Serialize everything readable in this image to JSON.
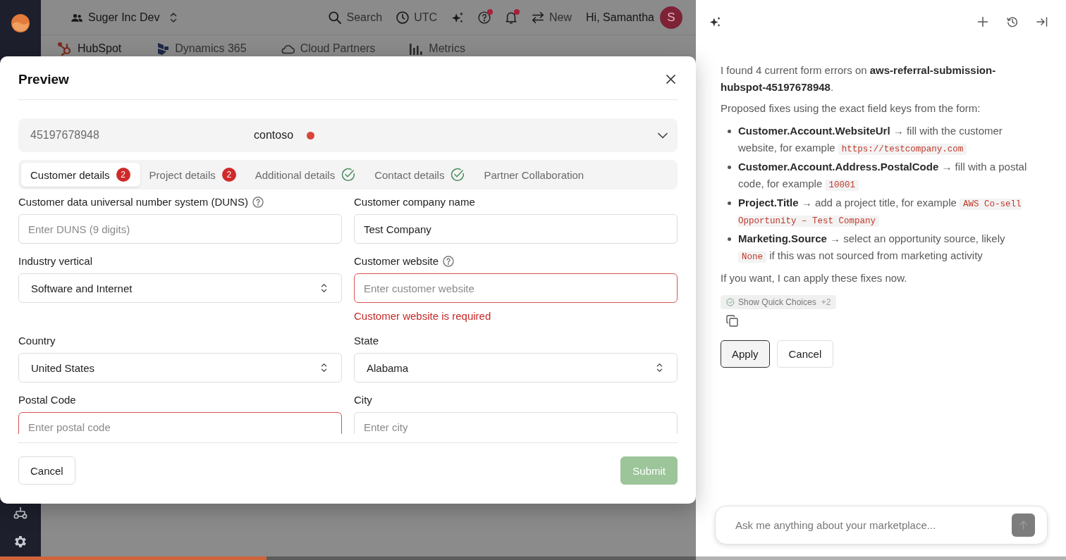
{
  "top_bar": {
    "workspace": "Suger Inc Dev",
    "search": "Search",
    "timezone": "UTC",
    "help": {
      "unread": true
    },
    "notifications": {
      "unread": true
    },
    "new": "New",
    "greeting": "Hi, Samantha",
    "avatar": "S"
  },
  "nav_tabs": [
    {
      "label": "HubSpot",
      "selected": true
    },
    {
      "label": "Dynamics 365",
      "selected": false
    },
    {
      "label": "Cloud Partners",
      "selected": false
    },
    {
      "label": "Metrics",
      "selected": false
    }
  ],
  "dialog": {
    "title": "Preview",
    "record": {
      "id": "45197678948",
      "name": "contoso",
      "error": true
    },
    "steps": [
      {
        "label": "Customer details",
        "selected": true,
        "kind": "errors",
        "count": "2"
      },
      {
        "label": "Project details",
        "selected": false,
        "kind": "errors",
        "count": "2"
      },
      {
        "label": "Additional details",
        "selected": false,
        "kind": "complete"
      },
      {
        "label": "Contact details",
        "selected": false,
        "kind": "complete"
      },
      {
        "label": "Partner Collaboration",
        "selected": false,
        "kind": "plain"
      }
    ],
    "fields": [
      {
        "label": "Customer data universal number system (DUNS)",
        "kind": "input",
        "help": true,
        "placeholder": "Enter DUNS (9 digits)",
        "invalid": false
      },
      {
        "label": "Customer company name",
        "kind": "input",
        "help": false,
        "value": "Test Company",
        "invalid": false
      },
      {
        "label": "Industry vertical",
        "kind": "select",
        "help": false,
        "value": "Software and Internet",
        "invalid": false
      },
      {
        "label": "Customer website",
        "kind": "input",
        "help": true,
        "placeholder": "Enter customer website",
        "invalid": true,
        "error": "Customer website is required"
      },
      {
        "label": "Country",
        "kind": "select",
        "help": false,
        "value": "United States",
        "invalid": false
      },
      {
        "label": "State",
        "kind": "select",
        "help": false,
        "value": "Alabama",
        "invalid": false
      },
      {
        "label": "Postal Code",
        "kind": "input",
        "help": false,
        "placeholder": "Enter postal code",
        "invalid": true
      },
      {
        "label": "City",
        "kind": "input",
        "help": false,
        "placeholder": "Enter city",
        "invalid": false
      }
    ],
    "footer": {
      "cancel": "Cancel",
      "submit": {
        "label": "Submit",
        "disabled": true
      }
    }
  },
  "assistant": {
    "intro": "I found 4 current form errors on **aws-referral-submission-hubspot-45197678948**.",
    "lead": "Proposed fixes using the exact field keys from the form:",
    "fixes": [
      {
        "field": "Customer.Account.WebsiteUrl",
        "parts": [
          {
            "kind": "text",
            "text": "→ fill with the customer website, for example"
          },
          {
            "kind": "code",
            "text": "https://testcompany.com"
          }
        ]
      },
      {
        "field": "Customer.Account.Address.PostalCode",
        "parts": [
          {
            "kind": "text",
            "text": "→ fill with a postal code, for example"
          },
          {
            "kind": "code",
            "text": "10001"
          }
        ]
      },
      {
        "field": "Project.Title",
        "parts": [
          {
            "kind": "text",
            "text": "→ add a project title, for example"
          },
          {
            "kind": "code",
            "text": "AWS Co-sell Opportunity – Test Company"
          }
        ]
      },
      {
        "field": "Marketing.Source",
        "parts": [
          {
            "kind": "text",
            "text": "→ select an opportunity source, likely"
          },
          {
            "kind": "code",
            "text": "None"
          },
          {
            "kind": "text",
            "text": "if this was not sourced from marketing activity"
          }
        ]
      }
    ],
    "closing": "If you want, I can apply these fixes now.",
    "quick_choices": {
      "label": "Show Quick Choices",
      "count": "+2"
    },
    "actions": [
      {
        "label": "Apply",
        "selected": true
      },
      {
        "label": "Cancel",
        "selected": false
      }
    ],
    "composer": {
      "placeholder": "Ask me anything about your marketplace..."
    }
  },
  "loading_bar": {
    "level": 0.25
  }
}
